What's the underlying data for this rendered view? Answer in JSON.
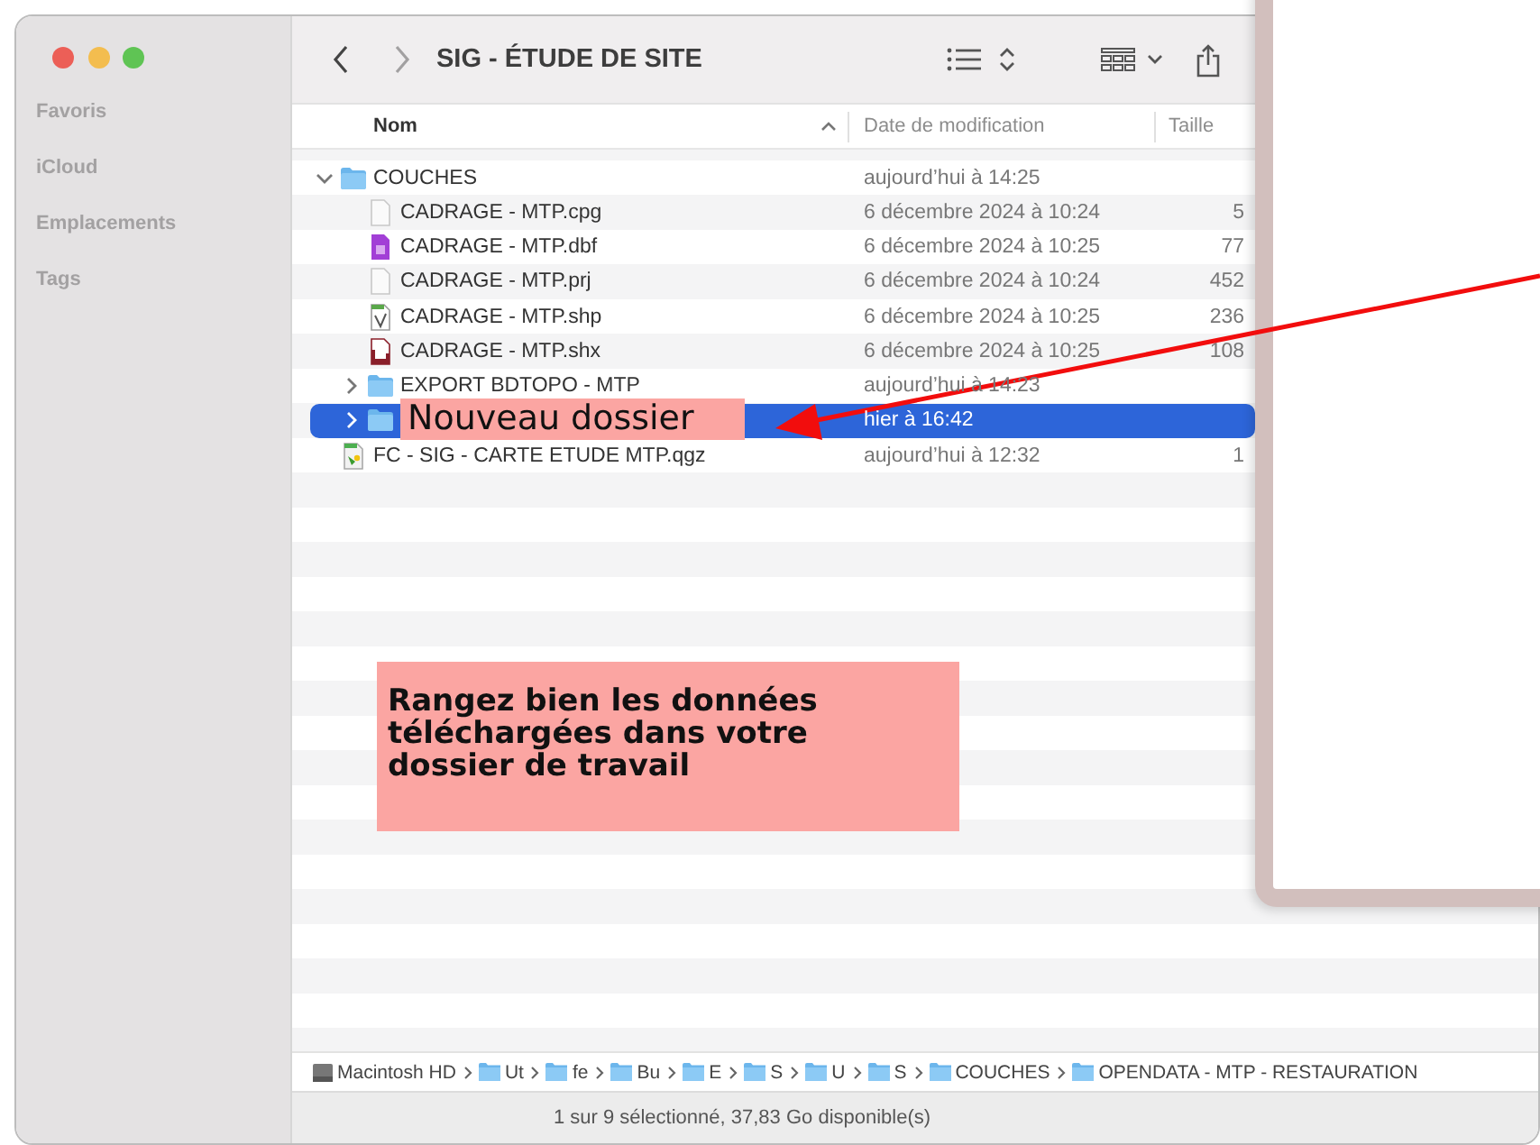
{
  "window": {
    "title": "SIG - ÉTUDE DE SITE"
  },
  "toolbar": {
    "back_enabled": true,
    "forward_enabled": false
  },
  "sidebar": {
    "sections": [
      "Favoris",
      "iCloud",
      "Emplacements",
      "Tags"
    ]
  },
  "table": {
    "columns": [
      {
        "label": "Nom",
        "sorted": true
      },
      {
        "label": "Date de modification",
        "sorted": false
      },
      {
        "label": "Taille",
        "sorted": false
      }
    ],
    "rows": [
      {
        "name": "COUCHES",
        "kind": "folder",
        "expanded": true,
        "selected": false,
        "modified": "aujourd’hui à 14:25",
        "children": [
          {
            "name": "CADRAGE - MTP.cpg",
            "kind": "document",
            "selected": false,
            "modified": "6 décembre 2024 à 10:24",
            "size": "5"
          },
          {
            "name": "CADRAGE - MTP.dbf",
            "kind": "database",
            "selected": false,
            "modified": "6 décembre 2024 à 10:25",
            "size": "77"
          },
          {
            "name": "CADRAGE - MTP.prj",
            "kind": "document",
            "selected": false,
            "modified": "6 décembre 2024 à 10:24",
            "size": "452"
          },
          {
            "name": "CADRAGE - MTP.shp",
            "kind": "vector",
            "selected": false,
            "modified": "6 décembre 2024 à 10:25",
            "size": "236"
          },
          {
            "name": "CADRAGE - MTP.shx",
            "kind": "index",
            "selected": false,
            "modified": "6 décembre 2024 à 10:25",
            "size": "108"
          },
          {
            "name": "EXPORT BDTOPO - MTP",
            "kind": "folder",
            "expanded": false,
            "selected": false,
            "modified": "aujourd’hui à 14:23"
          },
          {
            "kind": "folder",
            "expanded": false,
            "selected": true,
            "modified": "hier à 16:42"
          }
        ]
      },
      {
        "name": "FC - SIG - CARTE ETUDE MTP.qgz",
        "kind": "project",
        "selected": false,
        "modified": "aujourd’hui à 12:32",
        "size": "1"
      }
    ]
  },
  "path_bar": [
    {
      "label": "Macintosh HD",
      "kind": "disk"
    },
    {
      "label": "Ut",
      "kind": "folder"
    },
    {
      "label": "fe",
      "kind": "folder"
    },
    {
      "label": "Bu",
      "kind": "folder"
    },
    {
      "label": "E",
      "kind": "folder"
    },
    {
      "label": "S",
      "kind": "folder"
    },
    {
      "label": "U",
      "kind": "folder"
    },
    {
      "label": "S",
      "kind": "folder"
    },
    {
      "label": "COUCHES",
      "kind": "folder"
    },
    {
      "label": "OPENDATA - MTP - RESTAURATION",
      "kind": "folder"
    }
  ],
  "status_bar": "1 sur 9 sélectionné, 37,83 Go disponible(s)",
  "annotations": [
    {
      "kind": "label",
      "text": "Nouveau dossier"
    },
    {
      "kind": "note",
      "text": "Rangez bien les données téléchargées dans votre dossier de travail"
    },
    {
      "kind": "arrow"
    }
  ]
}
